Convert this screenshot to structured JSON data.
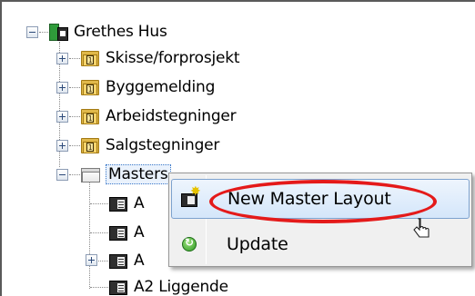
{
  "tree": {
    "root": {
      "label": "Grethes Hus",
      "icon": "house-icon"
    },
    "folders": [
      {
        "label": "Skisse/forprosjekt",
        "icon": "numbered-folder-icon"
      },
      {
        "label": "Byggemelding",
        "icon": "numbered-folder-icon"
      },
      {
        "label": "Arbeidstegninger",
        "icon": "numbered-folder-icon"
      },
      {
        "label": "Salgstegninger",
        "icon": "numbered-folder-icon"
      },
      {
        "label": "Masters",
        "icon": "folder-icon",
        "selected": true
      }
    ],
    "masters_children": [
      {
        "label": "A",
        "icon": "layout-icon"
      },
      {
        "label": "A",
        "icon": "layout-icon"
      },
      {
        "label": "A",
        "icon": "layout-icon"
      },
      {
        "label": "A2 Liggende",
        "icon": "layout-icon"
      }
    ]
  },
  "context_menu": {
    "items": [
      {
        "label": "New Master Layout",
        "icon": "new-layout-icon",
        "highlighted": true
      },
      {
        "label": "Update",
        "icon": "refresh-icon"
      }
    ]
  },
  "annotation": {
    "color": "#e41a1a",
    "shape": "ellipse"
  },
  "colors": {
    "menu_hover_border": "#7da2ce",
    "selection_border": "#3a78c9"
  }
}
